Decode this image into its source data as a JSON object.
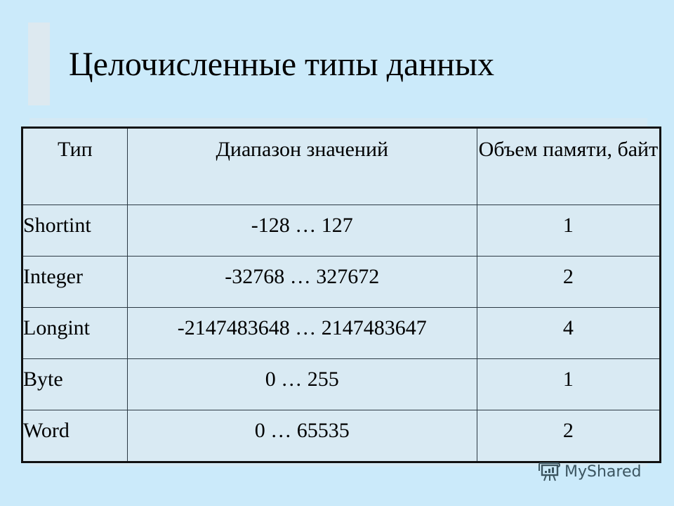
{
  "slide": {
    "title": "Целочисленные типы данных"
  },
  "table": {
    "headers": [
      "Тип",
      "Диапазон значений",
      "Объем памяти, байт"
    ],
    "rows": [
      {
        "type": "Shortint",
        "range": "-128 … 127",
        "size": "1"
      },
      {
        "type": "Integer",
        "range": "-32768 … 327672",
        "size": "2"
      },
      {
        "type": "Longint",
        "range": "-2147483648 … 2147483647",
        "size": "4"
      },
      {
        "type": "Byte",
        "range": "0 … 255",
        "size": "1"
      },
      {
        "type": "Word",
        "range": "0 … 65535",
        "size": "2"
      }
    ]
  },
  "watermark": {
    "icon": "presentation-board-icon",
    "label": "MyShared"
  },
  "colors": {
    "background": "#cbeafa",
    "table_fill": "#d9eaf3",
    "watermark_text": "#3c5560"
  }
}
